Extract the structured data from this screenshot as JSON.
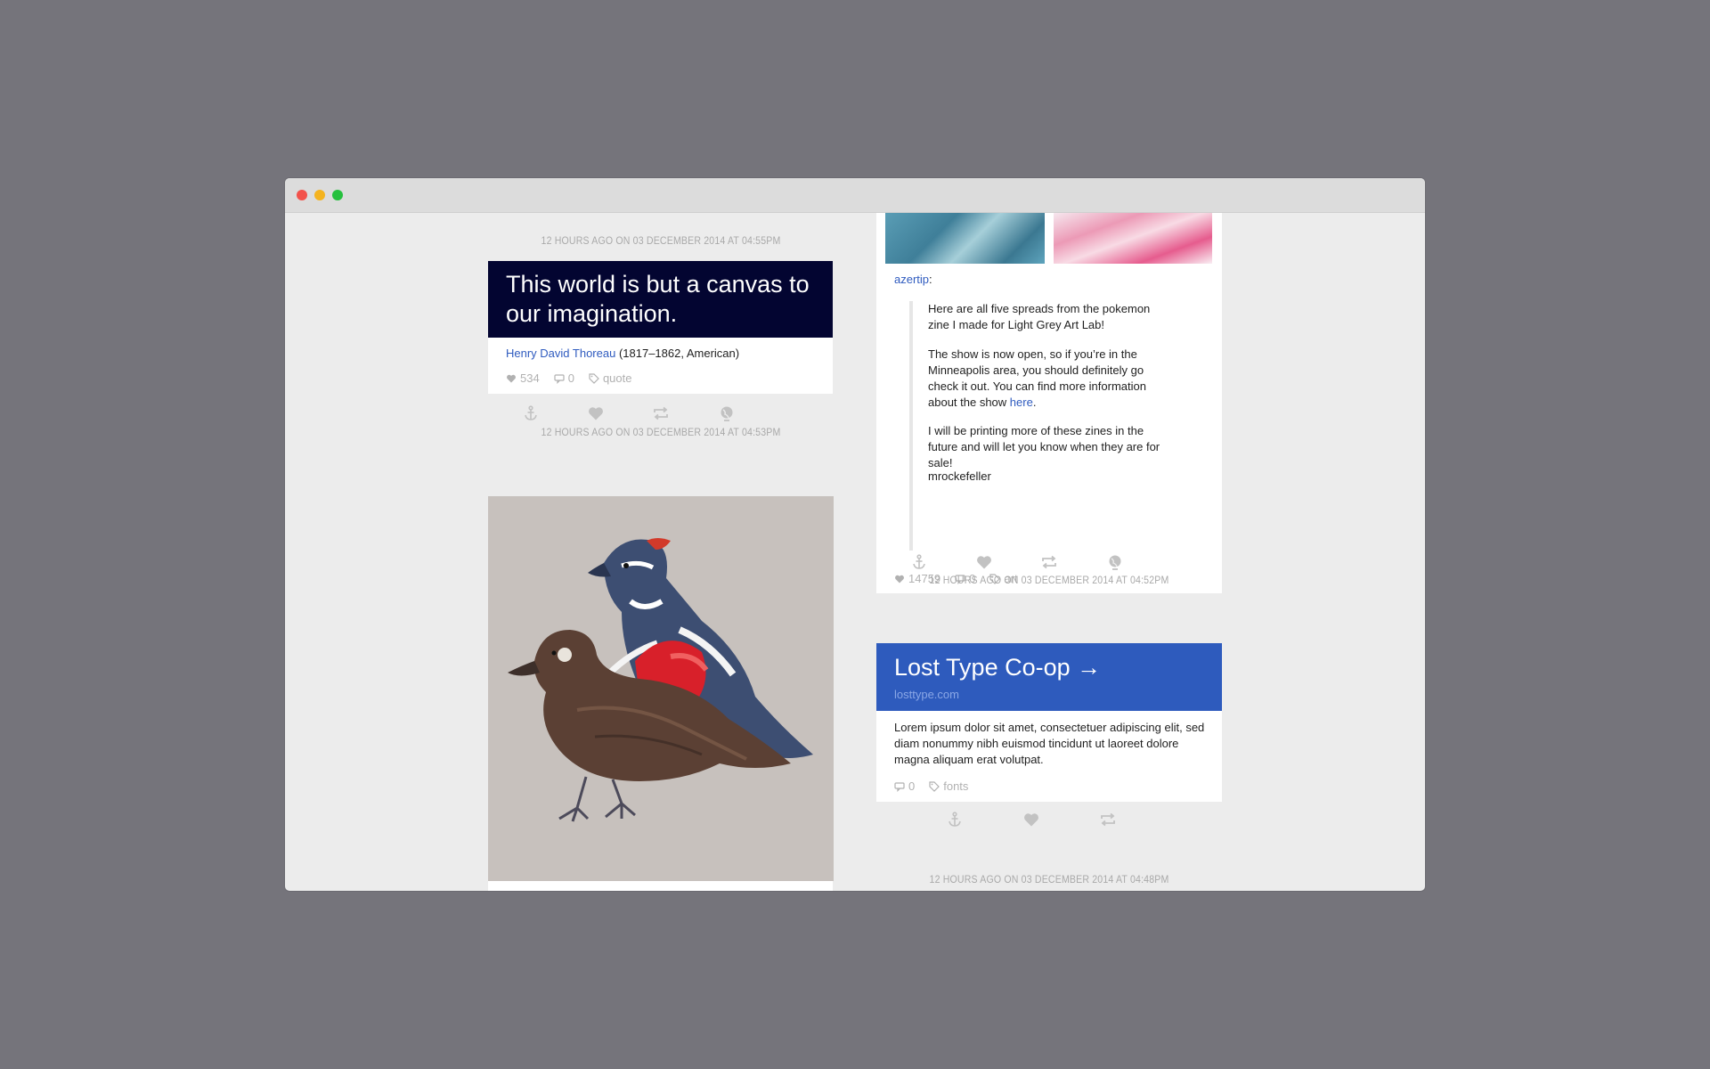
{
  "window": {
    "traffic_lights": [
      "close",
      "minimize",
      "zoom"
    ],
    "colors": {
      "close": "#f2524b",
      "minimize": "#f4b31f",
      "zoom": "#26c03e"
    }
  },
  "posts": {
    "quote": {
      "timestamp": "12 hours ago on 03 December 2014 at 04:55pm",
      "text": "This world is but a canvas to our imagination.",
      "author": "Henry David Thoreau",
      "author_meta": "(1817–1862, American)",
      "likes": "534",
      "comments": "0",
      "tag": "quote",
      "head_color": "#030531"
    },
    "photo": {
      "timestamp": "12 hours ago on 03 December 2014 at 04:53pm",
      "image": "harlequin-ducks-illustration"
    },
    "reblog": {
      "user": "azertip",
      "colon": ":",
      "paragraph1": "Here are all five spreads from the pokemon zine I made for Light Grey Art Lab!",
      "paragraph2_before_link": "The show is now open, so if you’re in the Minneapolis area, you should definitely go check it out. You can find more information about the show ",
      "paragraph2_link": "here",
      "paragraph2_after_link": ".",
      "paragraph3": "I will be printing more of these zines in the future and will let you know when they are for sale!",
      "source_user": "mrockefeller",
      "likes": "14759",
      "comments": "0",
      "tag": "art"
    },
    "link": {
      "timestamp": "12 hours ago on 03 December 2014 at 04:52pm",
      "title": "Lost Type Co-op →",
      "url": "losttype.com",
      "description": "Lorem ipsum dolor sit amet, consectetuer adipiscing elit, sed diam nonummy nibh euismod tincidunt ut laoreet dolore magna aliquam erat volutpat.",
      "comments": "0",
      "tag": "fonts",
      "head_color": "#2e5bbd"
    },
    "next": {
      "timestamp": "12 hours ago on 03 December 2014 at 04:48pm"
    }
  },
  "icons": {
    "permalink": "anchor-icon",
    "like": "heart-icon",
    "reblog": "reblog-icon",
    "reply": "globe-icon",
    "likes_stat": "heart-icon",
    "comments_stat": "comment-icon",
    "tag_stat": "tag-icon"
  },
  "accent": "#2f5bbf"
}
